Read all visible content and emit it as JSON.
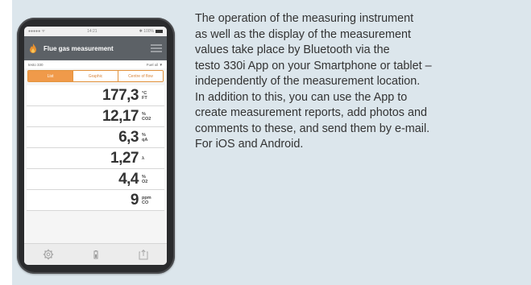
{
  "phone": {
    "status": {
      "left": "●●●●● ᯤ",
      "time": "14:21",
      "right": "✱ 100%"
    },
    "app_title": "Flue gas measurement",
    "device_name": "testo 330",
    "fuel": "Fuel oil ▼",
    "tabs": [
      "List",
      "Graphic",
      "Centre of flow"
    ],
    "active_tab": "List",
    "readings": [
      {
        "value": "177,3",
        "unit_top": "°C",
        "unit_bottom": "FT"
      },
      {
        "value": "12,17",
        "unit_top": "%",
        "unit_bottom": "CO2"
      },
      {
        "value": "6,3",
        "unit_top": "%",
        "unit_bottom": "qA"
      },
      {
        "value": "1,27",
        "unit_top": "λ",
        "unit_bottom": ""
      },
      {
        "value": "4,4",
        "unit_top": "%",
        "unit_bottom": "O2"
      },
      {
        "value": "9",
        "unit_top": "ppm",
        "unit_bottom": "CO"
      }
    ],
    "bottom_icons": [
      "gear-icon",
      "battery-icon",
      "export-icon"
    ]
  },
  "description_lines": [
    "The operation of the measuring instrument",
    "as well as the display of the measurement",
    "values take place by Bluetooth via the",
    "testo 330i App on your Smartphone or tablet –",
    "independently of the measurement location.",
    "In addition to this, you can use the App to",
    "create measurement reports, add photos and",
    "comments to these, and send them by e-mail.",
    "For iOS and Android."
  ],
  "colors": {
    "panel": "#dce6ec",
    "accent": "#f09a4a",
    "titlebar": "#5c6166"
  }
}
